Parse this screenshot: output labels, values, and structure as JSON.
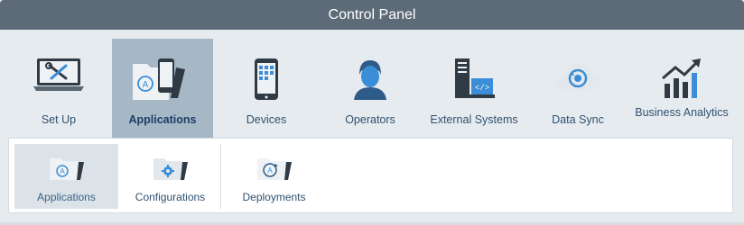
{
  "title": "Control Panel",
  "nav": {
    "items": [
      {
        "label": "Set Up",
        "icon": "laptop-tools-icon"
      },
      {
        "label": "Applications",
        "icon": "applications-folder-icon",
        "active": true
      },
      {
        "label": "Devices",
        "icon": "mobile-device-icon"
      },
      {
        "label": "Operators",
        "icon": "operator-user-icon"
      },
      {
        "label": "External Systems",
        "icon": "external-systems-icon"
      },
      {
        "label": "Data Sync",
        "icon": "data-sync-cloud-icon"
      },
      {
        "label": "Business Analytics",
        "icon": "analytics-chart-icon"
      }
    ]
  },
  "subnav": {
    "items": [
      {
        "label": "Applications",
        "icon": "applications-folder-icon",
        "active": true
      },
      {
        "label": "Configurations",
        "icon": "configurations-folder-icon"
      },
      {
        "label": "Deployments",
        "icon": "deployments-folder-icon"
      }
    ]
  },
  "colors": {
    "titlebar": "#5c6b77",
    "active_nav": "#a6b7c6",
    "label_text": "#2f5170",
    "accent_blue": "#3a8dd6",
    "icon_dark": "#2f3a44"
  }
}
